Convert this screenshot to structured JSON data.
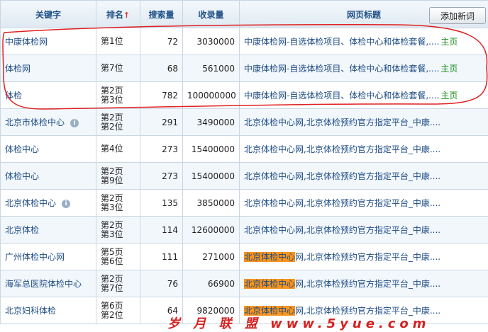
{
  "headers": {
    "keyword": "关键字",
    "rank": "排名",
    "rank_arrow": "↑",
    "search": "搜索量",
    "indexed": "收录量",
    "title": "网页标题"
  },
  "add_button": "添加新词",
  "rows": [
    {
      "keyword": "中康体检网",
      "rank1": "第1位",
      "rank2": "",
      "search": "72",
      "indexed": "3030000",
      "hl": "",
      "title": "中康体检网-自选体检项目、体检中心和体检套餐,....",
      "more": "主页",
      "info": false
    },
    {
      "keyword": "体检网",
      "rank1": "第7位",
      "rank2": "",
      "search": "68",
      "indexed": "561000",
      "hl": "",
      "title": "中康体检网-自选体检项目、体检中心和体检套餐,....",
      "more": "主页",
      "info": false
    },
    {
      "keyword": "体检",
      "rank1": "第2页",
      "rank2": "第3位",
      "search": "782",
      "indexed": "100000000",
      "hl": "",
      "title": "中康体检网-自选体检项目、体检中心和体检套餐,....",
      "more": "主页",
      "info": false
    },
    {
      "keyword": "北京市体检中心",
      "rank1": "第2页",
      "rank2": "第2位",
      "search": "291",
      "indexed": "3490000",
      "hl": "",
      "title": "北京体检中心网,北京体检预约官方指定平台_中康....",
      "more": "",
      "info": true
    },
    {
      "keyword": "体检中心",
      "rank1": "第4位",
      "rank2": "",
      "search": "273",
      "indexed": "15400000",
      "hl": "",
      "title": "北京体检中心网,北京体检预约官方指定平台_中康....",
      "more": "",
      "info": false
    },
    {
      "keyword": "体检中心",
      "rank1": "第2页",
      "rank2": "第9位",
      "search": "273",
      "indexed": "15400000",
      "hl": "",
      "title": "北京体检中心网,北京体检预约官方指定平台_中康....",
      "more": "",
      "info": false
    },
    {
      "keyword": "北京体检中心",
      "rank1": "第2页",
      "rank2": "第3位",
      "search": "135",
      "indexed": "3850000",
      "hl": "",
      "title": "北京体检中心网,北京体检预约官方指定平台_中康....",
      "more": "",
      "info": true
    },
    {
      "keyword": "北京体检",
      "rank1": "第2页",
      "rank2": "第3位",
      "search": "114",
      "indexed": "12600000",
      "hl": "",
      "title": "北京体检中心网,北京体检预约官方指定平台_中康....",
      "more": "",
      "info": false
    },
    {
      "keyword": "广州体检中心网",
      "rank1": "第5页",
      "rank2": "第6位",
      "search": "111",
      "indexed": "271000",
      "hl": "北京体检中心",
      "title": "网,北京体检预约官方指定平台_中康....",
      "more": "",
      "info": false
    },
    {
      "keyword": "海军总医院体检中心",
      "rank1": "第2页",
      "rank2": "第7位",
      "search": "76",
      "indexed": "66900",
      "hl": "北京体检中心",
      "title": "网,北京体检预约官方指定平台_中康....",
      "more": "",
      "info": false
    },
    {
      "keyword": "北京妇科体检",
      "rank1": "第6页",
      "rank2": "第2位",
      "search": "64",
      "indexed": "9820000",
      "hl": "北京体检中心",
      "title": "网,北京体检预约官方指定平台_中康....",
      "more": "",
      "info": false
    }
  ],
  "watermark": "岁 月 联 盟   www.5yue.com",
  "colors": {
    "header_text": "#1f4f86",
    "link": "#1c4b84",
    "more": "#138a13",
    "highlight": "#f7941d",
    "annotation": "#e02020"
  }
}
